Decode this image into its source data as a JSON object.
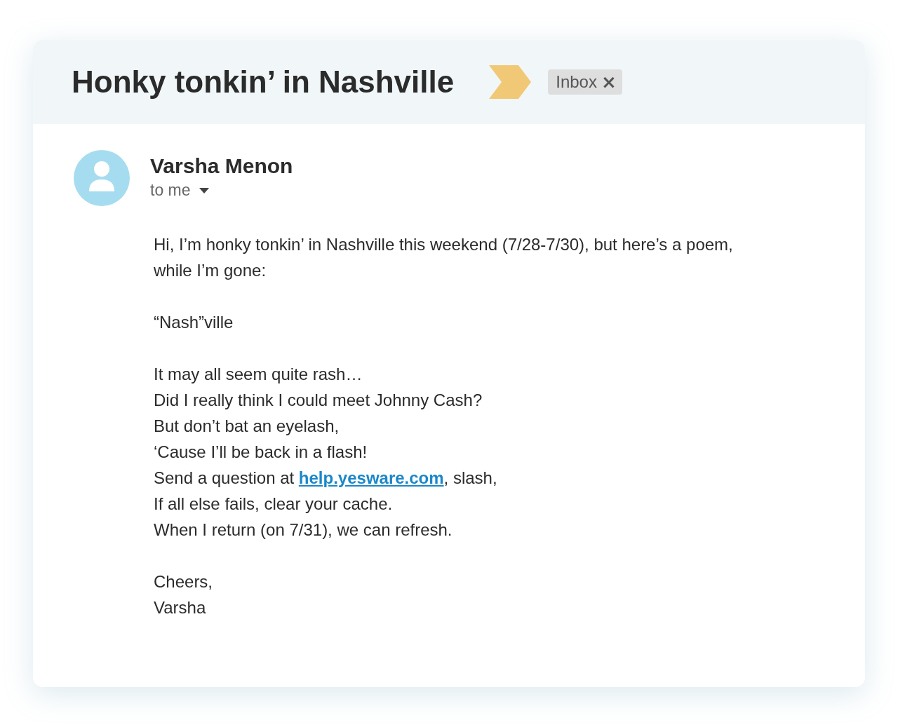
{
  "subject": "Honky tonkin’ in Nashville",
  "label": {
    "text": "Inbox",
    "close": "×"
  },
  "sender": {
    "name": "Varsha Menon",
    "recipient": "to me"
  },
  "body": [
    {
      "lines": [
        {
          "kind": "text",
          "text": "Hi, I’m honky tonkin’ in Nashville this weekend (7/28-7/30), but here’s a poem, while I’m gone:"
        }
      ]
    },
    {
      "lines": [
        {
          "kind": "text",
          "text": "“Nash”ville"
        }
      ]
    },
    {
      "lines": [
        {
          "kind": "text",
          "text": "It may all seem quite rash…"
        },
        {
          "kind": "text",
          "text": "Did I really think I could meet Johnny Cash?"
        },
        {
          "kind": "text",
          "text": "But don’t bat an eyelash,"
        },
        {
          "kind": "text",
          "text": "‘Cause I’ll be back in a flash!"
        },
        {
          "kind": "link",
          "before": "Send a question at ",
          "link": "help.yesware.com",
          "after": ", slash,"
        },
        {
          "kind": "text",
          "text": "If all else fails, clear your cache."
        },
        {
          "kind": "text",
          "text": "When I return (on 7/31), we can refresh."
        }
      ]
    },
    {
      "lines": [
        {
          "kind": "text",
          "text": "Cheers,"
        },
        {
          "kind": "text",
          "text": "Varsha"
        }
      ]
    }
  ]
}
